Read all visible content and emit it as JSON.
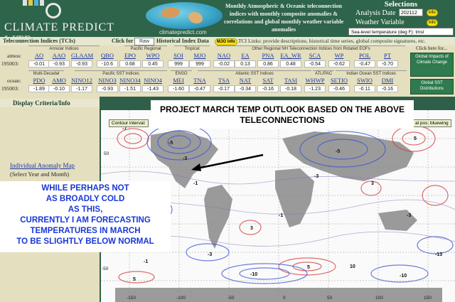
{
  "header": {
    "logo_text": "CLIMATE PREDICT LITE",
    "globe_url": "climatepredict.com",
    "tagline": "Monthly Atmospheric & Oceanic teleconnection indices with monthly composite anomalies & correlations and global monthly weather variable anomalies",
    "selections_title": "Selections",
    "analysis_date_label": "Analysis Date",
    "analysis_date_value": "202112",
    "weather_variable_label": "Weather Variable",
    "weather_variable_value": "Sea-level temperature (deg F): tmsl",
    "info_label": "info"
  },
  "toolbar": {
    "tci_label": "Teleconnection Indices (TCIs)",
    "click_for": "Click for",
    "raw_value": "Raw",
    "historical_data": "Historical Index Data",
    "mjo_info": "MJO info",
    "tci_links": "TCI Links: provide descriptions, historical time series, global composite signatures, etc."
  },
  "indices": {
    "row1_label": "atmos:",
    "row1_period": "195003:",
    "row2_label": "ocean:",
    "row2_period": "195003:",
    "groups_row1": [
      "Annular Indices",
      "Pacific Regional",
      "Tropical",
      "Other Regional NH Teleconnection Indices from Rotated EOFs"
    ],
    "groups_row2": [
      "Multi-Decadal",
      "Pacific SST Indices",
      "ENSO",
      "Atlantic SST Indices",
      "ATL/PAC",
      "Indian Ocean SST Indices"
    ],
    "row1": [
      {
        "code": "AO",
        "value": "-0.01"
      },
      {
        "code": "AAO",
        "value": "-0.93"
      },
      {
        "code": "GLAAM",
        "value": "-0.93"
      },
      {
        "code": "QBO",
        "value": "-10.6"
      },
      {
        "code": "EPO",
        "value": "0.68"
      },
      {
        "code": "WPO",
        "value": "0.45"
      },
      {
        "code": "SOI",
        "value": "999"
      },
      {
        "code": "MJO",
        "value": "999"
      },
      {
        "code": "NAO",
        "value": "-0.02"
      },
      {
        "code": "EA",
        "value": "0.13"
      },
      {
        "code": "PNA",
        "value": "0.86"
      },
      {
        "code": "EA_WR",
        "value": "0.48"
      },
      {
        "code": "SCA",
        "value": "-0.54"
      },
      {
        "code": "WP",
        "value": "-0.62"
      },
      {
        "code": "POL",
        "value": "-0.47"
      },
      {
        "code": "PT",
        "value": "-0.70"
      }
    ],
    "row2": [
      {
        "code": "PDO",
        "value": "-1.89"
      },
      {
        "code": "AMO",
        "value": "-0.10"
      },
      {
        "code": "NINO12",
        "value": "-1.17"
      },
      {
        "code": "NINO3",
        "value": "-0.93"
      },
      {
        "code": "NINO34",
        "value": "-1.51"
      },
      {
        "code": "NINO4",
        "value": "-1.43"
      },
      {
        "code": "MEI",
        "value": "-1.60"
      },
      {
        "code": "TNA",
        "value": "-0.47"
      },
      {
        "code": "TSA",
        "value": "-0.17"
      },
      {
        "code": "NAT",
        "value": "-0.34"
      },
      {
        "code": "SAT",
        "value": "-0.16"
      },
      {
        "code": "TASI",
        "value": "-0.18"
      },
      {
        "code": "WHWP",
        "value": "-1.23"
      },
      {
        "code": "SETIO",
        "value": "-0.46"
      },
      {
        "code": "SWIO",
        "value": "-0.11"
      },
      {
        "code": "DMI",
        "value": "-0.16"
      }
    ],
    "click_here": "Click here for...",
    "global_impacts_btn": "Global Impacts of Climate Change",
    "global_sst_btn": "Global SST Distributions"
  },
  "left_panel": {
    "display_header": "Display Criteria/Info",
    "individual_map_link": "Individual Anomaly Map",
    "individual_map_sub": "(Select Year and Month)"
  },
  "map": {
    "contour_label": "Contour interval:",
    "anomaly_label": "al pos; bluewing",
    "lat_labels": [
      "50",
      "0",
      "-50"
    ],
    "lon_labels": [
      "-150",
      "-100",
      "-50",
      "0",
      "50",
      "100",
      "150"
    ],
    "contour_values": [
      "-7",
      "-5",
      "-3",
      "-1",
      "5",
      "3",
      "-5",
      "-3",
      "-10",
      "-1",
      "5",
      "-3",
      "-1",
      "-10",
      "-13",
      "5",
      "10",
      "3",
      "-1",
      "-3"
    ]
  },
  "annotations": {
    "top": "PROJECT MARCH TEMP OUTLOOK BASED ON THE ABOVE TELECONNECTIONS",
    "left_line1": "WHILE PERHAPS NOT",
    "left_line2": "AS BROADLY COLD",
    "left_line3": "AS THIS,",
    "left_line4": "CURRENTLY I AM FORECASTING",
    "left_line5": "TEMPERATURES IN MARCH",
    "left_line6": "TO BE SLIGHTLY BELOW NORMAL"
  },
  "colors": {
    "header_bg": "#2e6449",
    "panel_bg": "#e4dfbe",
    "link": "#1a37a8",
    "annotation_blue": "#1838d6",
    "info_yellow": "#f6e11a"
  }
}
